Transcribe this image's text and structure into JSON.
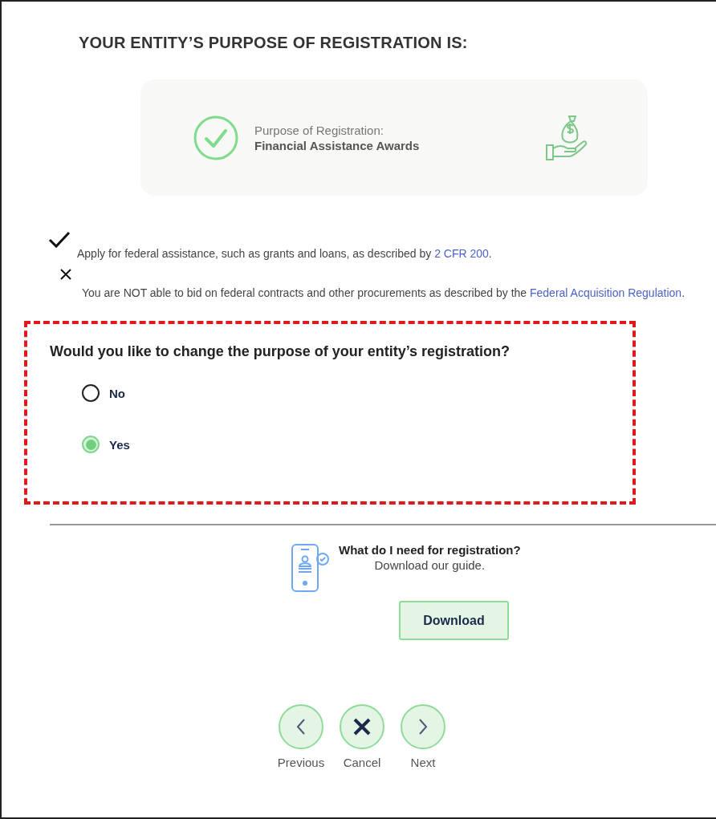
{
  "title": "YOUR ENTITY’S PURPOSE OF REGISTRATION IS:",
  "summary": {
    "label": "Purpose of Registration:",
    "value": "Financial Assistance Awards"
  },
  "items": [
    {
      "kind": "allowed",
      "text": "Apply for federal assistance, such as grants and loans, as described by ",
      "link": "2 CFR 200",
      "after": "."
    },
    {
      "kind": "denied",
      "text": "You are NOT able to bid on federal contracts and other procurements as described by the ",
      "link": "Federal Acquisition Regulation",
      "after": "."
    }
  ],
  "question": {
    "text": "Would you like to change the purpose of your entity’s registration?",
    "options": [
      {
        "label": "No",
        "selected": false
      },
      {
        "label": "Yes",
        "selected": true
      }
    ]
  },
  "guide": {
    "title": "What do I need for registration?",
    "subtitle": "Download our guide.",
    "button": "Download"
  },
  "nav": [
    {
      "kind": "previous",
      "label": "Previous"
    },
    {
      "kind": "cancel",
      "label": "Cancel"
    },
    {
      "kind": "next",
      "label": "Next"
    }
  ]
}
